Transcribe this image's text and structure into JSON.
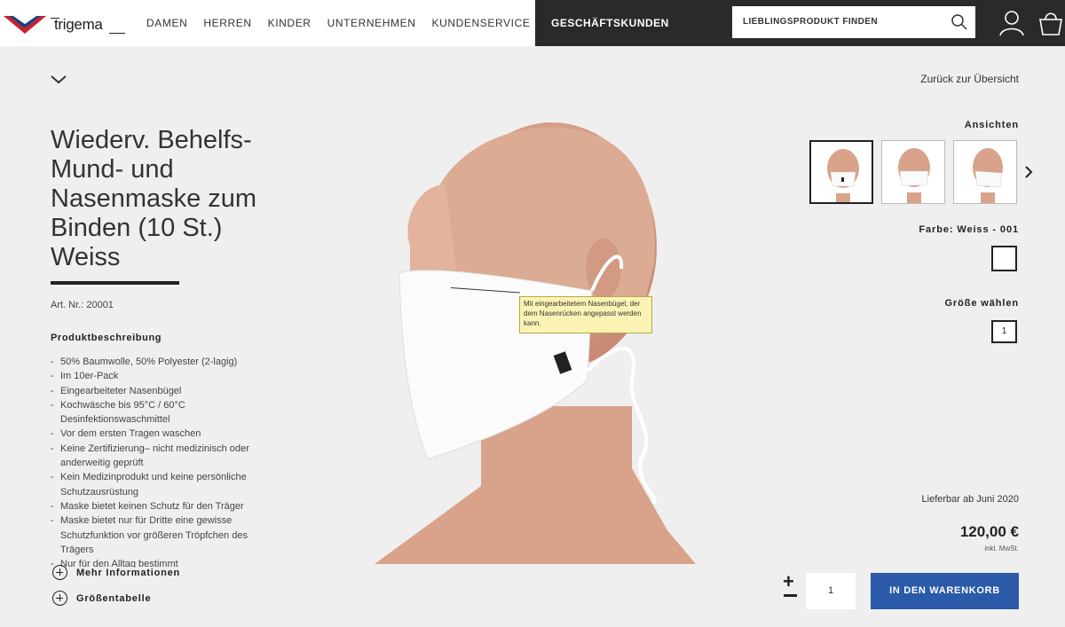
{
  "header": {
    "logo_text": "trigema",
    "nav": [
      "DAMEN",
      "HERREN",
      "KINDER",
      "UNTERNEHMEN",
      "KUNDENSERVICE"
    ],
    "business_label": "GESCHÄFTSKUNDEN",
    "search_placeholder": "LIEBLINGSPRODUKT FINDEN",
    "icons": [
      "search-icon",
      "user-icon",
      "basket-icon"
    ]
  },
  "page": {
    "back_link": "Zurück zur Übersicht",
    "title": "Wiederv. Behelfs- Mund- und Nasenmaske zum Binden (10 St.) Weiss",
    "article_number": "Art. Nr.: 20001",
    "description_title": "Produktbeschreibung",
    "description_items": [
      "50% Baumwolle, 50% Polyester (2-lagig)",
      "Im 10er-Pack",
      "Eingearbeiteter Nasenbügel",
      "Kochwäsche bis 95°C / 60°C Desinfektionswaschmittel",
      "Vor dem ersten Tragen waschen",
      "Keine Zertifizierung– nicht medizinisch oder anderweitig geprüft",
      "Kein Medizinprodukt und keine persönliche Schutzausrüstung",
      "Maske bietet keinen Schutz für den Träger",
      "Maske bietet nur für Dritte eine gewisse Schutzfunktion vor größeren Tröpfchen des Trägers",
      "Nur für den Alltag bestimmt"
    ],
    "more_info_label": "Mehr Informationen",
    "size_table_label": "Größentabelle",
    "tooltip_text": "Mit eingearbeitetem Nasenbügel, der dem Nasenrücken angepasst werden kann."
  },
  "sidebar": {
    "views_label": "Ansichten",
    "color_label": "Farbe: Weiss - 001",
    "size_label": "Größe wählen",
    "size_value": "1",
    "availability": "Lieferbar ab Juni 2020",
    "price": "120,00 €",
    "tax_note": "inkl. MwSt.",
    "quantity": "1",
    "cart_button": "IN DEN WARENKORB"
  },
  "colors": {
    "header_dark": "#2a2a2a",
    "cart_blue": "#2b5aa8",
    "logo_red": "#c8202f",
    "logo_blue": "#1f3c7a",
    "tooltip_bg": "#fbf3b4"
  }
}
